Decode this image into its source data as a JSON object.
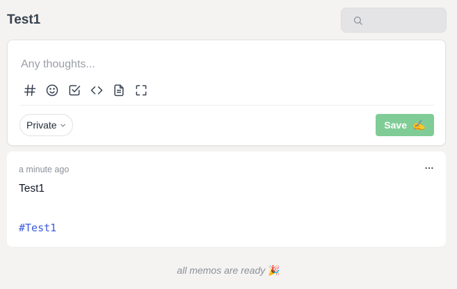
{
  "header": {
    "title": "Test1",
    "search": {
      "placeholder": "",
      "value": "",
      "icon": "search-icon"
    }
  },
  "editor": {
    "placeholder": "Any thoughts...",
    "toolbar": {
      "tools": [
        "hash-icon",
        "emoji-icon",
        "checkbox-icon",
        "code-icon",
        "file-icon",
        "fullscreen-icon"
      ]
    },
    "visibility": {
      "value": "Private",
      "icon": "chevron-down-icon"
    },
    "save": {
      "label": "Save",
      "emoji": "✍️",
      "color": "#80cc96"
    }
  },
  "memos": [
    {
      "time": "a minute ago",
      "text": "Test1",
      "tag": "#Test1",
      "more_icon": "more-horizontal-icon"
    }
  ],
  "footer": {
    "text": "all memos are ready",
    "emoji": "🎉"
  },
  "colors": {
    "background": "#f4f3f1",
    "card": "#ffffff",
    "tag": "#3b5bdb",
    "muted": "#8b9099"
  }
}
